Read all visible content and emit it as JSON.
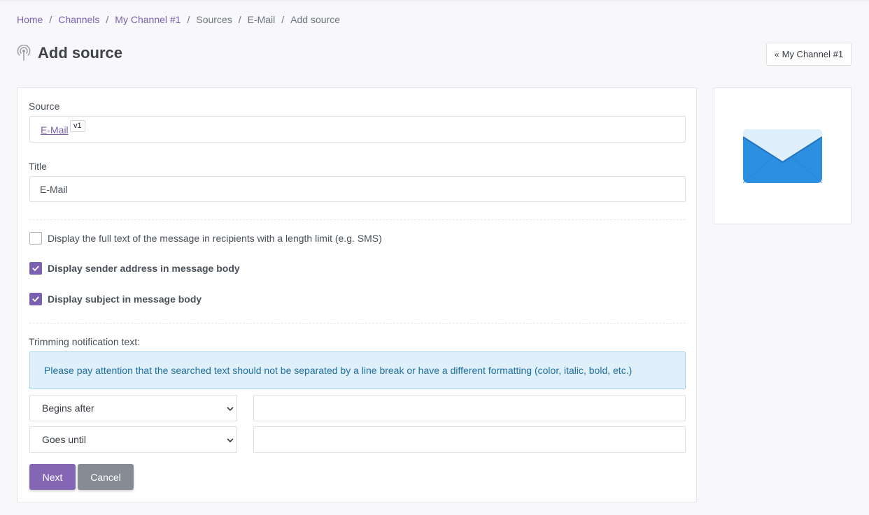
{
  "breadcrumb": {
    "items": [
      {
        "label": "Home",
        "link": true
      },
      {
        "label": "Channels",
        "link": true
      },
      {
        "label": "My Channel #1",
        "link": true
      },
      {
        "label": "Sources",
        "link": false
      },
      {
        "label": "E-Mail",
        "link": false
      },
      {
        "label": "Add source",
        "link": false
      }
    ],
    "separator": "/"
  },
  "header": {
    "title": "Add source",
    "icon": "broadcast-icon",
    "back_button": {
      "chevron": "«",
      "label": "My Channel #1"
    }
  },
  "form": {
    "source": {
      "label": "Source",
      "value": "E-Mail",
      "version": "v1"
    },
    "title_field": {
      "label": "Title",
      "value": "E-Mail"
    },
    "checkboxes": [
      {
        "label": "Display the full text of the message in recipients with a length limit (e.g. SMS)",
        "checked": false
      },
      {
        "label": "Display sender address in message body",
        "checked": true
      },
      {
        "label": "Display subject in message body",
        "checked": true
      }
    ],
    "trimming": {
      "label": "Trimming notification text:",
      "alert": "Please pay attention that the searched text should not be separated by a line break or have a different formatting (color, italic, bold, etc.)",
      "begin_select": {
        "selected": "Begins after",
        "value": ""
      },
      "end_select": {
        "selected": "Goes until",
        "value": ""
      }
    },
    "next_label": "Next",
    "cancel_label": "Cancel"
  },
  "side": {
    "icon": "envelope-icon"
  },
  "colors": {
    "accent": "#7b5fb1",
    "primary_button": "#8366b4",
    "secondary_button": "#868c93",
    "alert_bg": "#e0f0fb",
    "alert_text": "#1b6ea0",
    "envelope_blue": "#2d8fe0"
  }
}
